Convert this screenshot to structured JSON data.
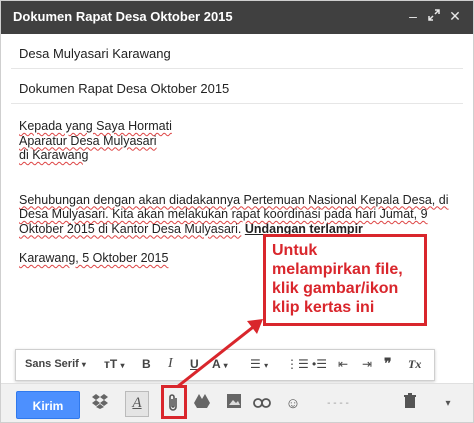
{
  "window": {
    "title": "Dokumen Rapat Desa Oktober 2015"
  },
  "fields": {
    "to": "Desa Mulyasari Karawang",
    "subject": "Dokumen Rapat Desa Oktober 2015"
  },
  "body": {
    "line1": "Kepada yang Saya Hormati",
    "line2": "Aparatur Desa Mulyasari",
    "line3": "di Karawang",
    "para_part1": "Sehubungan dengan akan diadakannya Pertemuan Nasional Kepala Desa, di Desa Mulyasari. Kita akan melakukan rapat koordinasi pada hari Jumat, 9 Oktober 2015 di Kantor Desa Mulyasari.",
    "para_bold": "Undangan terlampir",
    "closing": "Karawang, 5 Oktober 2015"
  },
  "callout": {
    "text": "Untuk melampirkan file, klik gambar/ikon klip kertas ini"
  },
  "format_toolbar": {
    "font": "Sans Serif",
    "size_icon": "text-size-icon",
    "bold": "B",
    "italic": "I",
    "underline": "U",
    "color": "A",
    "align_icon": "align-icon",
    "numbered_icon": "numbered-list-icon",
    "bulleted_icon": "bulleted-list-icon",
    "indent_less_icon": "indent-less-icon",
    "indent_more_icon": "indent-more-icon",
    "quote": "❞",
    "clear": "Tx"
  },
  "bottom_toolbar": {
    "send_label": "Kirim",
    "icons": [
      "dropbox-icon",
      "formatting-icon",
      "attach-icon",
      "drive-icon",
      "photo-icon",
      "link-icon",
      "emoji-icon",
      "discard-icon",
      "more-options-icon"
    ]
  },
  "colors": {
    "titlebar": "#404040",
    "send": "#4d90fe",
    "callout": "#d9262c"
  }
}
